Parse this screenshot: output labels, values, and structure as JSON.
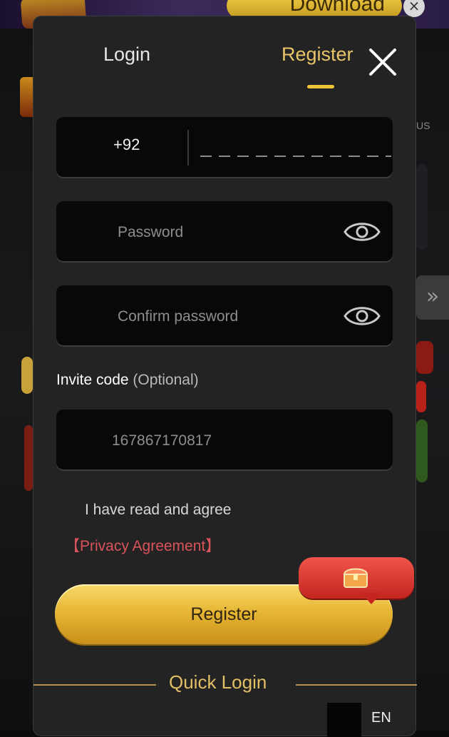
{
  "background": {
    "download_label": "Download",
    "close_label": "×",
    "side_label": "US",
    "chevron": "»"
  },
  "modal": {
    "tabs": [
      {
        "label": "Login",
        "active": false
      },
      {
        "label": "Register",
        "active": true
      }
    ],
    "close_icon": "close-x-icon",
    "phone": {
      "country_code": "+92",
      "value": ""
    },
    "password": {
      "placeholder": "Password",
      "icon": "eye-icon"
    },
    "confirm_password": {
      "placeholder": "Confirm password",
      "icon": "eye-icon"
    },
    "invite": {
      "label": "Invite code",
      "optional": "(Optional)",
      "value": "167867170817"
    },
    "agree_text": "I have read and agree",
    "privacy_link": "【Privacy Agreement】",
    "register_button": "Register",
    "gift_icon": "treasure-chest-icon",
    "quick_login": "Quick Login",
    "language": "EN"
  },
  "colors": {
    "accent_gold": "#f0c43a",
    "tab_active": "#e9c56a",
    "link_red": "#d9545a",
    "panel": "#232323"
  }
}
